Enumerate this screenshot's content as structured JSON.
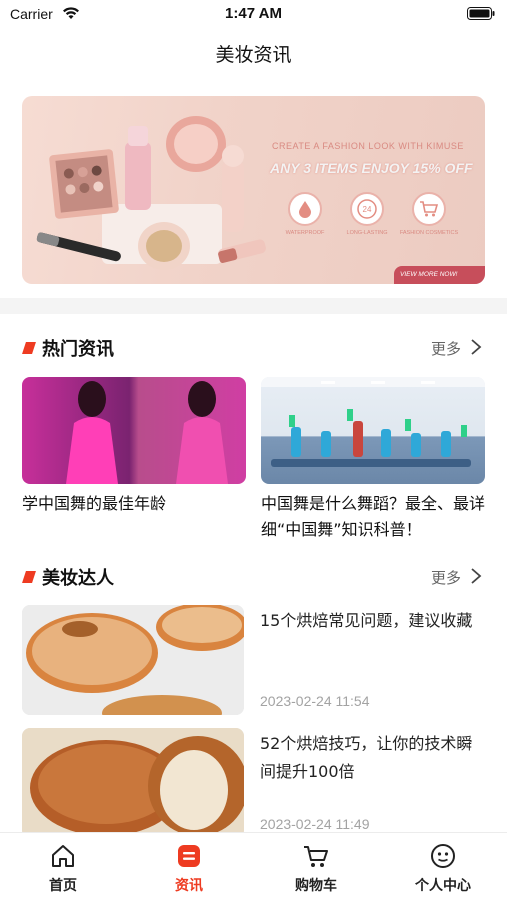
{
  "status_bar": {
    "carrier": "Carrier",
    "time": "1:47 AM"
  },
  "nav": {
    "title": "美妆资讯"
  },
  "banner": {
    "headline": "CREATE A FASHION LOOK WITH KIMUSE",
    "offer": "ANY 3 ITEMS ENJOY 15% OFF",
    "features": [
      {
        "label": "WATERPROOF",
        "icon": "drop-icon"
      },
      {
        "label": "LONG-LASTING",
        "icon": "clock-24-icon"
      },
      {
        "label": "FASHION COSMETICS",
        "icon": "cart-icon"
      }
    ],
    "cta": "VIEW MORE NOW!"
  },
  "hot_news": {
    "title": "热门资讯",
    "more": "更多",
    "items": [
      {
        "title": "学中国舞的最佳年龄"
      },
      {
        "title": "中国舞是什么舞蹈？最全、最详细“中国舞”知识科普！"
      }
    ]
  },
  "experts": {
    "title": "美妆达人",
    "more": "更多",
    "items": [
      {
        "title": "15个烘焙常见问题，建议收藏",
        "date": "2023-02-24 11:54"
      },
      {
        "title": "52个烘焙技巧，让你的技术瞬间提升100倍",
        "date": "2023-02-24 11:49"
      }
    ]
  },
  "tab_bar": {
    "tabs": [
      {
        "label": "首页",
        "icon": "home-icon"
      },
      {
        "label": "资讯",
        "icon": "news-icon"
      },
      {
        "label": "购物车",
        "icon": "cart-icon"
      },
      {
        "label": "个人中心",
        "icon": "profile-icon"
      }
    ],
    "active_index": 1
  },
  "colors": {
    "accent": "#ee3b21",
    "text": "#222222",
    "muted": "#a3a3a3"
  }
}
